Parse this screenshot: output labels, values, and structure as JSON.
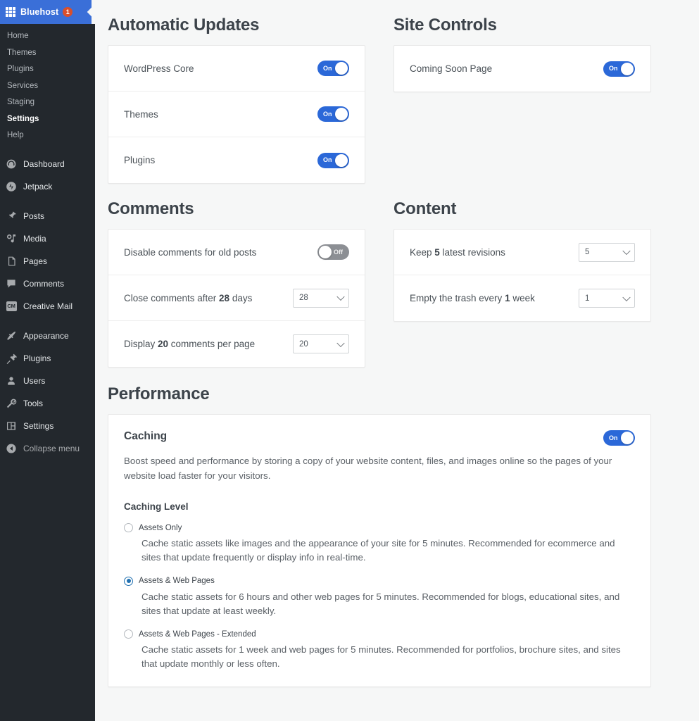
{
  "sidebar": {
    "brand": {
      "label": "Bluehost",
      "badge": "1",
      "icon": "grid-icon",
      "color": "#3a6fd8"
    },
    "bluehost_menu": [
      {
        "label": "Home",
        "active": false
      },
      {
        "label": "Themes",
        "active": false
      },
      {
        "label": "Plugins",
        "active": false
      },
      {
        "label": "Services",
        "active": false
      },
      {
        "label": "Staging",
        "active": false
      },
      {
        "label": "Settings",
        "active": true
      },
      {
        "label": "Help",
        "active": false
      }
    ],
    "wp_menu": [
      {
        "label": "Dashboard",
        "icon": "dashboard-icon"
      },
      {
        "label": "Jetpack",
        "icon": "jetpack-icon"
      },
      {
        "label": "Posts",
        "icon": "pin-icon"
      },
      {
        "label": "Media",
        "icon": "media-icon"
      },
      {
        "label": "Pages",
        "icon": "pages-icon"
      },
      {
        "label": "Comments",
        "icon": "comment-icon"
      },
      {
        "label": "Creative Mail",
        "icon": "creative-mail-icon",
        "badge_text": "CM"
      },
      {
        "label": "Appearance",
        "icon": "paintbrush-icon"
      },
      {
        "label": "Plugins",
        "icon": "plug-icon"
      },
      {
        "label": "Users",
        "icon": "user-icon"
      },
      {
        "label": "Tools",
        "icon": "wrench-icon"
      },
      {
        "label": "Settings",
        "icon": "settings-icon"
      },
      {
        "label": "Collapse menu",
        "icon": "collapse-icon"
      }
    ]
  },
  "sections": {
    "automatic_updates": {
      "title": "Automatic Updates",
      "rows": [
        {
          "label": "WordPress Core",
          "toggle_state": "On"
        },
        {
          "label": "Themes",
          "toggle_state": "On"
        },
        {
          "label": "Plugins",
          "toggle_state": "On"
        }
      ]
    },
    "site_controls": {
      "title": "Site Controls",
      "rows": [
        {
          "label": "Coming Soon Page",
          "toggle_state": "On"
        }
      ]
    },
    "comments": {
      "title": "Comments",
      "rows": [
        {
          "label_pre": "Disable comments for old posts",
          "label_bold": "",
          "label_post": "",
          "control": "toggle",
          "toggle_state": "Off"
        },
        {
          "label_pre": "Close comments after ",
          "label_bold": "28",
          "label_post": " days",
          "control": "select",
          "value": "28"
        },
        {
          "label_pre": "Display ",
          "label_bold": "20",
          "label_post": " comments per page",
          "control": "select",
          "value": "20"
        }
      ]
    },
    "content": {
      "title": "Content",
      "rows": [
        {
          "label_pre": "Keep ",
          "label_bold": "5",
          "label_post": " latest revisions",
          "control": "select",
          "value": "5"
        },
        {
          "label_pre": "Empty the trash every ",
          "label_bold": "1",
          "label_post": " week",
          "control": "select",
          "value": "1"
        }
      ]
    },
    "performance": {
      "title": "Performance",
      "caching": {
        "title": "Caching",
        "toggle_state": "On",
        "description": "Boost speed and performance by storing a copy of your website content, files, and images online so the pages of your website load faster for your visitors.",
        "level_title": "Caching Level",
        "options": [
          {
            "label": "Assets Only",
            "selected": false,
            "description": "Cache static assets like images and the appearance of your site for 5 minutes. Recommended for ecommerce and sites that update frequently or display info in real-time."
          },
          {
            "label": "Assets & Web Pages",
            "selected": true,
            "description": "Cache static assets for 6 hours and other web pages for 5 minutes. Recommended for blogs, educational sites, and sites that update at least weekly."
          },
          {
            "label": "Assets & Web Pages - Extended",
            "selected": false,
            "description": "Cache static assets for 1 week and web pages for 5 minutes. Recommended for portfolios, brochure sites, and sites that update monthly or less often."
          }
        ]
      }
    }
  },
  "colors": {
    "accent_blue": "#2b68d8",
    "brand_blue": "#3a6fd8",
    "sidebar_bg": "#23282d",
    "page_bg": "#f6f7f7",
    "toggle_off": "#8c8f94",
    "radio_selected": "#2271b1"
  }
}
